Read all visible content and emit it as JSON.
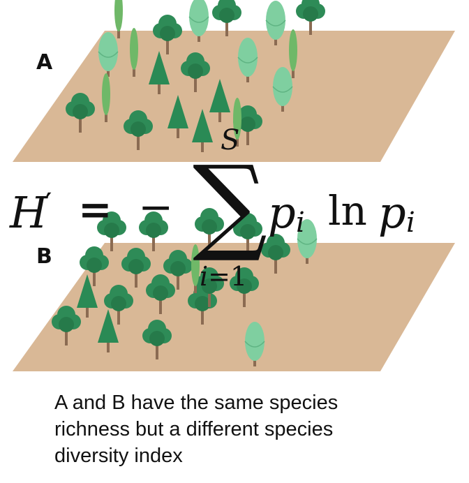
{
  "plots": {
    "a_label": "A",
    "b_label": "B",
    "ground_color": "#d9b896",
    "tree_green": "#2e8b57",
    "tree_light": "#7fcfa0",
    "trunk_color": "#8b6b52"
  },
  "formula": {
    "lhs": "H",
    "prime": "′",
    "equals": "=",
    "minus": "−",
    "sum_symbol": "∑",
    "upper_limit": "S",
    "lower_index": "i",
    "lower_equals_one": "=1",
    "p": "p",
    "subscript": "i",
    "ln": "ln",
    "p2": "p",
    "subscript2": "i"
  },
  "caption": {
    "line1": "A and B have the same species",
    "line2": "richness but a different species",
    "line3": "diversity index"
  }
}
